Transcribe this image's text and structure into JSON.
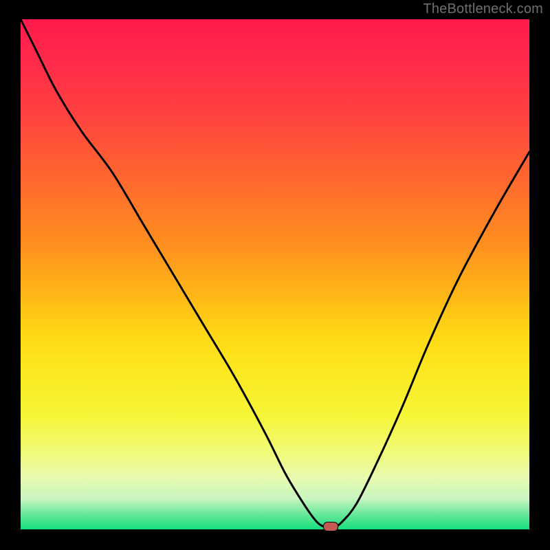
{
  "attribution": "TheBottleneck.com",
  "colors": {
    "page_bg": "#000000",
    "curve": "#000000",
    "marker_fill": "#c45a54",
    "gradient_top": "#ff1a4d",
    "gradient_bottom": "#17dd7e"
  },
  "chart_data": {
    "type": "line",
    "title": "",
    "xlabel": "",
    "ylabel": "",
    "xlim": [
      0,
      100
    ],
    "ylim": [
      0,
      100
    ],
    "x": [
      0,
      3,
      7,
      12,
      18,
      24,
      30,
      36,
      42,
      48,
      52,
      55,
      57,
      58.5,
      60,
      61.5,
      63,
      66,
      70,
      75,
      80,
      86,
      93,
      100
    ],
    "values": [
      100,
      94,
      86,
      78,
      70,
      60,
      50,
      40,
      30,
      19,
      11,
      6,
      3,
      1.2,
      0.4,
      0.4,
      1.3,
      5,
      13,
      24,
      36,
      49,
      62,
      74
    ],
    "flat_valley": {
      "x_start": 58,
      "x_end": 61,
      "y": 0.5
    },
    "marker": {
      "x": 61,
      "y": 0.5
    }
  }
}
